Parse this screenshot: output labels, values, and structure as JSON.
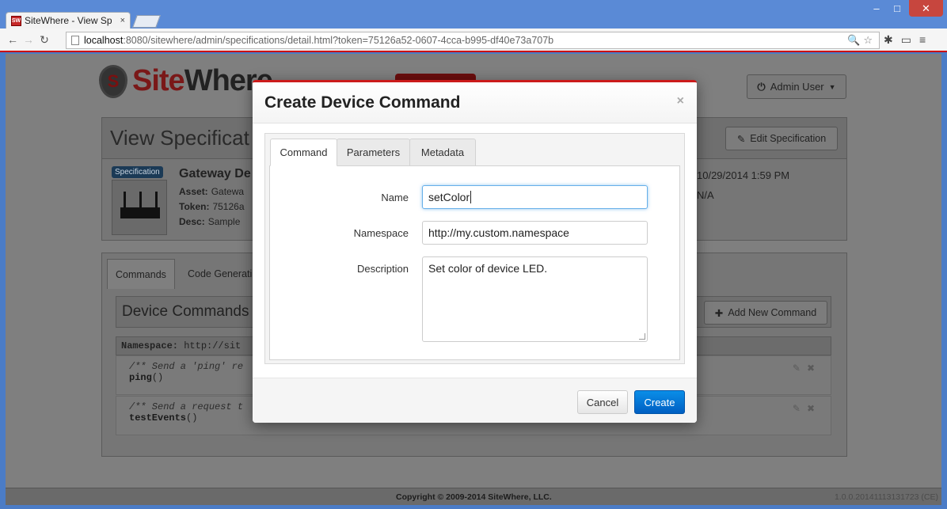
{
  "browser": {
    "tab_title": "SiteWhere - View Sp",
    "tab_close": "×",
    "favicon_text": "SW",
    "url_host": "localhost",
    "url_rest": ":8080/sitewhere/admin/specifications/detail.html?token=75126a52-0607-4cca-b995-df40e73a707b",
    "window_controls": {
      "minimize": "‒",
      "maximize": "□",
      "close": "✕"
    }
  },
  "header": {
    "logo_site": "Site",
    "logo_where": "Where",
    "user_button": "Admin User"
  },
  "spec": {
    "page_title": "View Specificat",
    "edit_button": "Edit Specification",
    "badge": "Specification",
    "name": "Gateway De",
    "asset_label": "Asset:",
    "asset_value": "Gatewa",
    "token_label": "Token:",
    "token_value": "75126a",
    "desc_label": "Desc:",
    "desc_value": "Sample",
    "created": "10/29/2014 1:59 PM",
    "updated": "N/A"
  },
  "tabs_panel": {
    "tabs": [
      "Commands",
      "Code Generati"
    ],
    "commands_title": "Device Commands",
    "add_button": "Add New Command",
    "namespace_label": "Namespace:",
    "namespace_value": "http://sit",
    "commands": [
      {
        "comment": "/** Send a 'ping' re",
        "call": "ping",
        "args": "()"
      },
      {
        "comment": "/** Send a request t",
        "call": "testEvents",
        "args": "()"
      }
    ]
  },
  "footer": {
    "copyright": "Copyright © 2009-2014 SiteWhere, LLC.",
    "version": "1.0.0.20141113131723 (CE)"
  },
  "modal": {
    "title": "Create Device Command",
    "close": "×",
    "tabs": [
      "Command",
      "Parameters",
      "Metadata"
    ],
    "active_tab": "Command",
    "fields": {
      "name_label": "Name",
      "name_value": "setColor",
      "namespace_label": "Namespace",
      "namespace_value": "http://my.custom.namespace",
      "description_label": "Description",
      "description_value": "Set color of device LED."
    },
    "cancel_button": "Cancel",
    "create_button": "Create"
  },
  "colors": {
    "accent_red": "#cc1b1b",
    "primary_button": "#0070d6",
    "focus_ring": "#66afe9",
    "spec_badge": "#1b3a56"
  }
}
